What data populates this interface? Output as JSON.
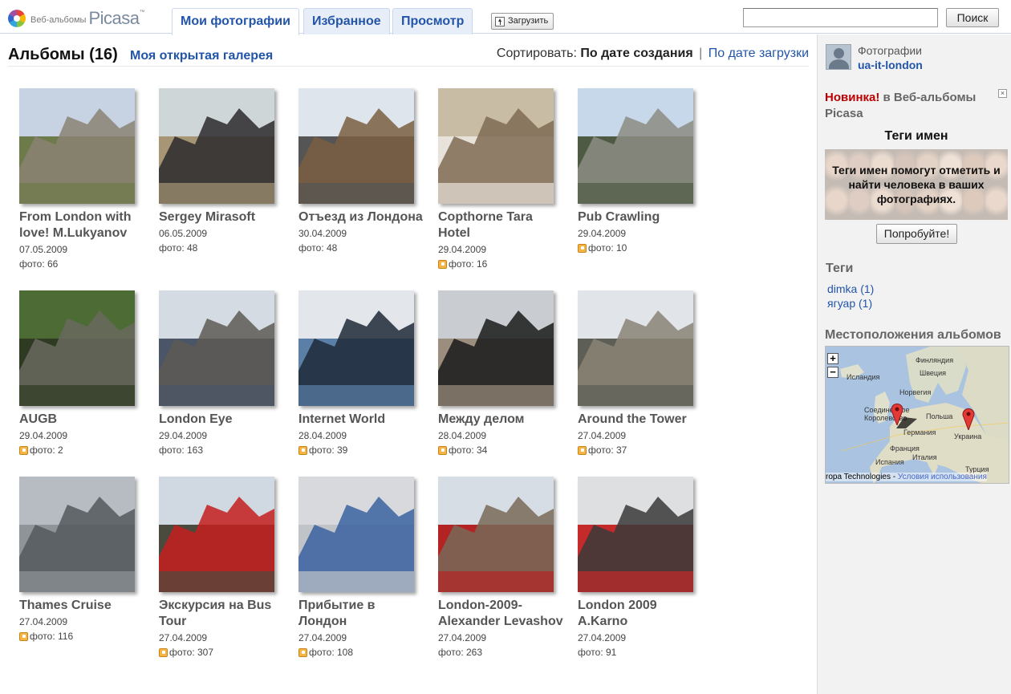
{
  "header": {
    "logo_small": "Веб-альбомы",
    "logo_big": "Picasa",
    "logo_tm": "™",
    "tabs": [
      {
        "label": "Мои фотографии",
        "active": true
      },
      {
        "label": "Избранное",
        "active": false
      },
      {
        "label": "Просмотр",
        "active": false
      }
    ],
    "upload_label": "Загрузить",
    "search_value": "",
    "search_button": "Поиск"
  },
  "main": {
    "albums_title": "Альбомы (16)",
    "gallery_link": "Моя открытая галерея",
    "sort_label": "Сортировать:",
    "sort_current": "По дате создания",
    "sort_separator": "|",
    "sort_other": "По дате загрузки",
    "albums": [
      {
        "title": "From London with love! M.Lukyanov",
        "date": "07.05.2009",
        "count": "фото: 66",
        "public_icon": false,
        "palette": [
          "#c7d3e2",
          "#8a8373",
          "#6d7a4a"
        ]
      },
      {
        "title": "Sergey Mirasoft",
        "date": "06.05.2009",
        "count": "фото: 48",
        "public_icon": false,
        "palette": [
          "#cfd6d8",
          "#2b2a2d",
          "#a69676"
        ]
      },
      {
        "title": "Отъезд из Лондона",
        "date": "30.04.2009",
        "count": "фото: 48",
        "public_icon": false,
        "palette": [
          "#dfe5ec",
          "#7a5f42",
          "#555"
        ]
      },
      {
        "title": "Copthorne Tara Hotel",
        "date": "29.04.2009",
        "count": "фото: 16",
        "public_icon": true,
        "palette": [
          "#c9bca4",
          "#7f6b53",
          "#e8e3da"
        ]
      },
      {
        "title": "Pub Crawling",
        "date": "29.04.2009",
        "count": "фото: 10",
        "public_icon": true,
        "palette": [
          "#c7d8ea",
          "#8c8c84",
          "#4f5a45"
        ]
      },
      {
        "title": "AUGB",
        "date": "29.04.2009",
        "count": "фото: 2",
        "public_icon": true,
        "palette": [
          "#4d6b34",
          "#6a6a5f",
          "#2e3b22"
        ]
      },
      {
        "title": "London Eye",
        "date": "29.04.2009",
        "count": "фото: 163",
        "public_icon": false,
        "palette": [
          "#d4dbe3",
          "#5e5a56",
          "#4a5568"
        ]
      },
      {
        "title": "Internet World",
        "date": "28.04.2009",
        "count": "фото: 39",
        "public_icon": true,
        "palette": [
          "#e3e7ec",
          "#1f2937",
          "#5b7fa6"
        ]
      },
      {
        "title": "Между делом",
        "date": "28.04.2009",
        "count": "фото: 34",
        "public_icon": true,
        "palette": [
          "#c9ccd1",
          "#1a1a1a",
          "#9c8e7e"
        ]
      },
      {
        "title": "Around the Tower",
        "date": "27.04.2009",
        "count": "фото: 37",
        "public_icon": true,
        "palette": [
          "#e1e5ea",
          "#8a8476",
          "#5d5e55"
        ]
      },
      {
        "title": "Thames Cruise",
        "date": "27.04.2009",
        "count": "фото: 116",
        "public_icon": true,
        "palette": [
          "#b7bcc2",
          "#55595e",
          "#8f9498"
        ]
      },
      {
        "title": "Экскурсия на Bus Tour",
        "date": "27.04.2009",
        "count": "фото: 307",
        "public_icon": true,
        "palette": [
          "#d0d8e2",
          "#c41e1e",
          "#4a4a3e"
        ]
      },
      {
        "title": "Прибытие в Лондон",
        "date": "27.04.2009",
        "count": "фото: 108",
        "public_icon": true,
        "palette": [
          "#d7d9dc",
          "#3a62a0",
          "#c0c3c8"
        ]
      },
      {
        "title": "London-2009-Alexander Levashov",
        "date": "27.04.2009",
        "count": "фото: 263",
        "public_icon": false,
        "palette": [
          "#d6dde4",
          "#786a58",
          "#b32323"
        ]
      },
      {
        "title": "London 2009 A.Karno",
        "date": "27.04.2009",
        "count": "фото: 91",
        "public_icon": false,
        "palette": [
          "#dedfe0",
          "#3a3a3a",
          "#c42a2a"
        ]
      }
    ]
  },
  "sidebar": {
    "owner_label": "Фотографии",
    "owner_name": "ua-it-london",
    "news_new": "Новинка!",
    "news_rest": "в Веб-альбомы Picasa",
    "close_label": "×",
    "promo_title": "Теги имен",
    "promo_text": "Теги имен помогут отметить и найти человека в ваших фотографиях.",
    "try_button": "Попробуйте!",
    "tags_title": "Теги",
    "tags": [
      "dimka (1)",
      "ягуар (1)"
    ],
    "locations_title": "Местоположения альбомов",
    "map": {
      "zoom_in": "+",
      "zoom_out": "−",
      "labels": [
        "Финляндия",
        "Исландия",
        "Швеция",
        "Норвегия",
        "Соединенное Королевство",
        "Польша",
        "Германия",
        "Украина",
        "Франция",
        "Италия",
        "Испания",
        "Турция"
      ],
      "credit": "ropa Technologies -",
      "terms": "Условия использования"
    }
  }
}
